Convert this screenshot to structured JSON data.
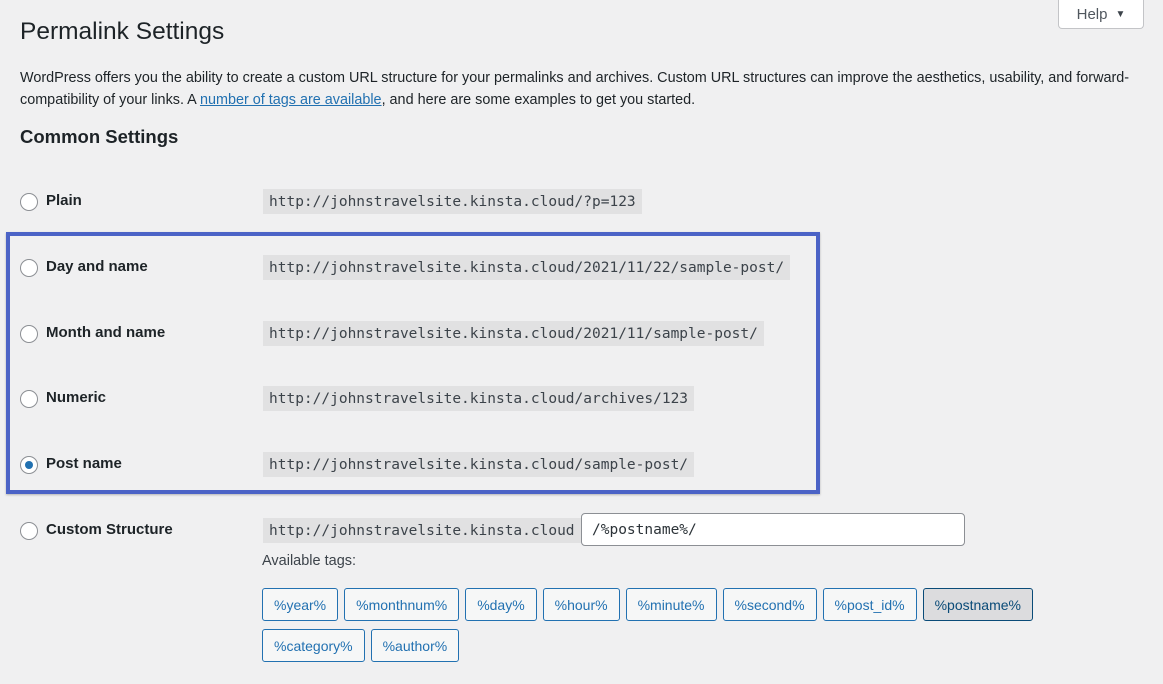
{
  "help": {
    "label": "Help",
    "icon": "caret-down-icon"
  },
  "page_title": "Permalink Settings",
  "intro": {
    "before": "WordPress offers you the ability to create a custom URL structure for your permalinks and archives. Custom URL structures can improve the aesthetics, usability, and forward-compatibility of your links. A ",
    "link": "number of tags are available",
    "after": ", and here are some examples to get you started."
  },
  "common_settings_title": "Common Settings",
  "options": [
    {
      "label": "Plain",
      "example": "http://johnstravelsite.kinsta.cloud/?p=123",
      "checked": false
    },
    {
      "label": "Day and name",
      "example": "http://johnstravelsite.kinsta.cloud/2021/11/22/sample-post/",
      "checked": false
    },
    {
      "label": "Month and name",
      "example": "http://johnstravelsite.kinsta.cloud/2021/11/sample-post/",
      "checked": false
    },
    {
      "label": "Numeric",
      "example": "http://johnstravelsite.kinsta.cloud/archives/123",
      "checked": false
    },
    {
      "label": "Post name",
      "example": "http://johnstravelsite.kinsta.cloud/sample-post/",
      "checked": true
    }
  ],
  "custom": {
    "label": "Custom Structure",
    "base": "http://johnstravelsite.kinsta.cloud",
    "value": "/%postname%/",
    "checked": false
  },
  "available_tags_label": "Available tags:",
  "tags": [
    {
      "label": "%year%",
      "active": false
    },
    {
      "label": "%monthnum%",
      "active": false
    },
    {
      "label": "%day%",
      "active": false
    },
    {
      "label": "%hour%",
      "active": false
    },
    {
      "label": "%minute%",
      "active": false
    },
    {
      "label": "%second%",
      "active": false
    },
    {
      "label": "%post_id%",
      "active": false
    },
    {
      "label": "%postname%",
      "active": true
    },
    {
      "label": "%category%",
      "active": false
    },
    {
      "label": "%author%",
      "active": false
    }
  ],
  "colors": {
    "accent": "#2271b1",
    "highlight_border": "#4b63c6",
    "background": "#f0f0f1"
  }
}
